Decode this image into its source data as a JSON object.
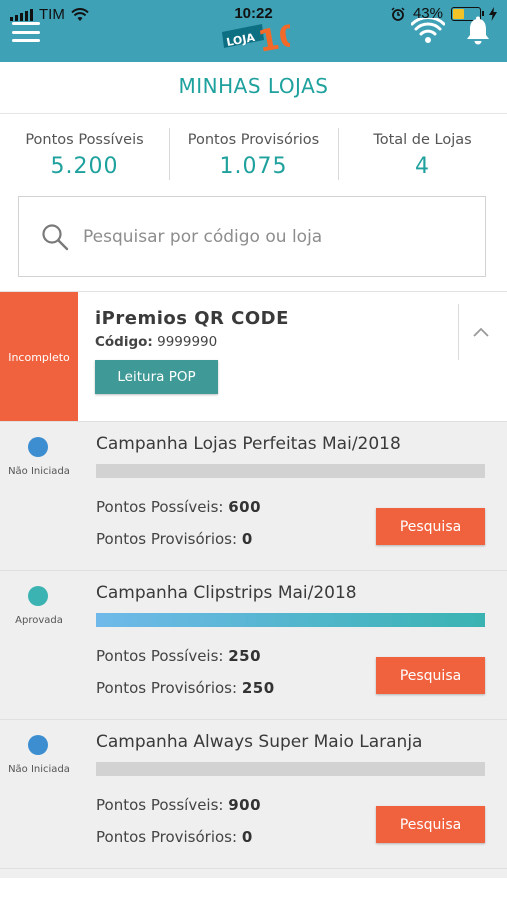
{
  "status_bar": {
    "carrier": "TIM",
    "time": "10:22",
    "battery": "43%",
    "battery_level": 0.43
  },
  "header": {
    "logo_text": "LOJA 10"
  },
  "page": {
    "title": "MINHAS LOJAS"
  },
  "stats": [
    {
      "label": "Pontos Possíveis",
      "value": "5.200"
    },
    {
      "label": "Pontos Provisórios",
      "value": "1.075"
    },
    {
      "label": "Total de Lojas",
      "value": "4"
    }
  ],
  "search": {
    "placeholder": "Pesquisar por código ou loja",
    "value": ""
  },
  "store": {
    "status": "Incompleto",
    "name": "iPremios QR CODE",
    "code_label": "Código:",
    "code": "9999990",
    "pop_button": "Leitura POP"
  },
  "campaigns": [
    {
      "status": "Não Iniciada",
      "dot_color": "#3d8ed0",
      "title": "Campanha Lojas Perfeitas Mai/2018",
      "progress": 0,
      "points_possible_label": "Pontos Possíveis:",
      "points_possible": "600",
      "points_provisional_label": "Pontos Provisórios:",
      "points_provisional": "0",
      "button": "Pesquisa"
    },
    {
      "status": "Aprovada",
      "dot_color": "#3ab3b2",
      "title": "Campanha Clipstrips Mai/2018",
      "progress": 1,
      "points_possible_label": "Pontos Possíveis:",
      "points_possible": "250",
      "points_provisional_label": "Pontos Provisórios:",
      "points_provisional": "250",
      "button": "Pesquisa"
    },
    {
      "status": "Não Iniciada",
      "dot_color": "#3d8ed0",
      "title": "Campanha Always Super Maio Laranja",
      "progress": 0,
      "points_possible_label": "Pontos Possíveis:",
      "points_possible": "900",
      "points_provisional_label": "Pontos Provisórios:",
      "points_provisional": "0",
      "button": "Pesquisa"
    }
  ],
  "colors": {
    "header_bg": "#3fa1b6",
    "accent_teal": "#1fa19e",
    "status_orange": "#f0623e",
    "pop_button": "#3f9a97"
  }
}
